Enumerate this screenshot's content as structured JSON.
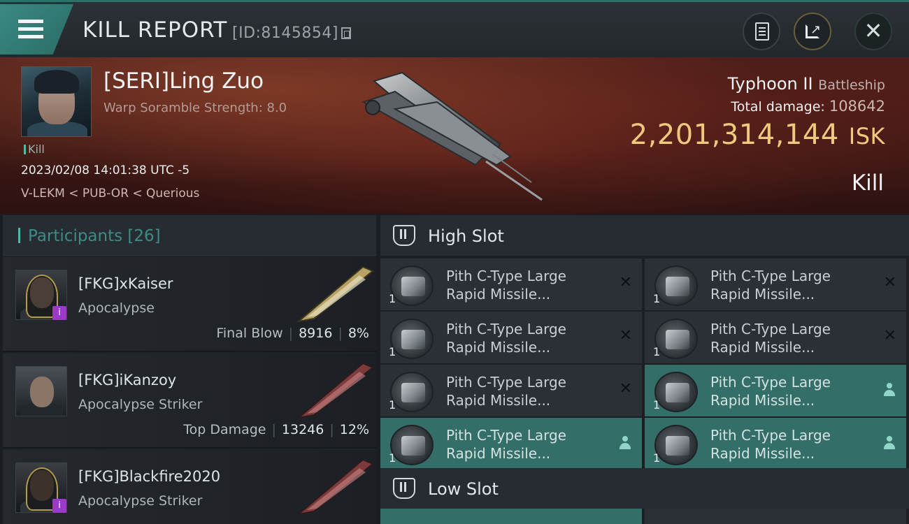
{
  "header": {
    "title": "KILL REPORT",
    "id_text": "[ID:8145854]"
  },
  "victim": {
    "name": "[SERI]Ling Zuo",
    "subtitle": "Warp Soramble Strength: 8.0",
    "tag": "Kill",
    "datetime": "2023/02/08 14:01:38 UTC -5",
    "location": "V-LEKM < PUB-OR < Querious",
    "ship_name": "Typhoon II",
    "ship_class": "Battleship",
    "damage_label": "Total damage:",
    "damage_value": "108642",
    "isk_value": "2,201,314,144",
    "isk_unit": "ISK",
    "result": "Kill"
  },
  "participants": {
    "title": "Participants",
    "count": "[26]",
    "items": [
      {
        "name": "[FKG]xKaiser",
        "ship": "Apocalypse",
        "stat_label": "Final Blow",
        "damage": "8916",
        "percent": "8%",
        "badge": "i"
      },
      {
        "name": "[FKG]iKanzoy",
        "ship": "Apocalypse Striker",
        "stat_label": "Top Damage",
        "damage": "13246",
        "percent": "12%",
        "badge": ""
      },
      {
        "name": "[FKG]Blackfire2020",
        "ship": "Apocalypse Striker",
        "stat_label": "",
        "damage": "",
        "percent": "",
        "badge": "i"
      }
    ]
  },
  "fitting": {
    "high_slot_title": "High Slot",
    "low_slot_title": "Low Slot",
    "high_slot_modules": [
      {
        "line1": "Pith C-Type Large",
        "line2": "Rapid Missile...",
        "qty": "1",
        "state": "destroyed"
      },
      {
        "line1": "Pith C-Type Large",
        "line2": "Rapid Missile...",
        "qty": "1",
        "state": "destroyed"
      },
      {
        "line1": "Pith C-Type Large",
        "line2": "Rapid Missile...",
        "qty": "1",
        "state": "destroyed"
      },
      {
        "line1": "Pith C-Type Large",
        "line2": "Rapid Missile...",
        "qty": "1",
        "state": "dropped"
      },
      {
        "line1": "Pith C-Type Large",
        "line2": "Rapid Missile...",
        "qty": "1",
        "state": "destroyed"
      },
      {
        "line1": "Pith C-Type Large",
        "line2": "Rapid Missile...",
        "qty": "1",
        "state": "destroyed"
      },
      {
        "line1": "Pith C-Type Large",
        "line2": "Rapid Missile...",
        "qty": "1",
        "state": "dropped"
      },
      {
        "line1": "Pith C-Type Large",
        "line2": "Rapid Missile...",
        "qty": "1",
        "state": "dropped"
      }
    ],
    "destroyed_symbol": "✕"
  },
  "icons": {
    "menu": "hamburger-menu-icon",
    "copy": "copy-icon",
    "clipboard": "clipboard-icon",
    "share": "share-icon",
    "close": "close-icon",
    "slot": "high-slot-icon",
    "dropped": "person-icon"
  },
  "colors": {
    "accent_teal": "#3a8a82",
    "isk_gold": "#f1c97e",
    "fitted_bg": "#346e69",
    "badge_purple": "#9b39c8"
  }
}
